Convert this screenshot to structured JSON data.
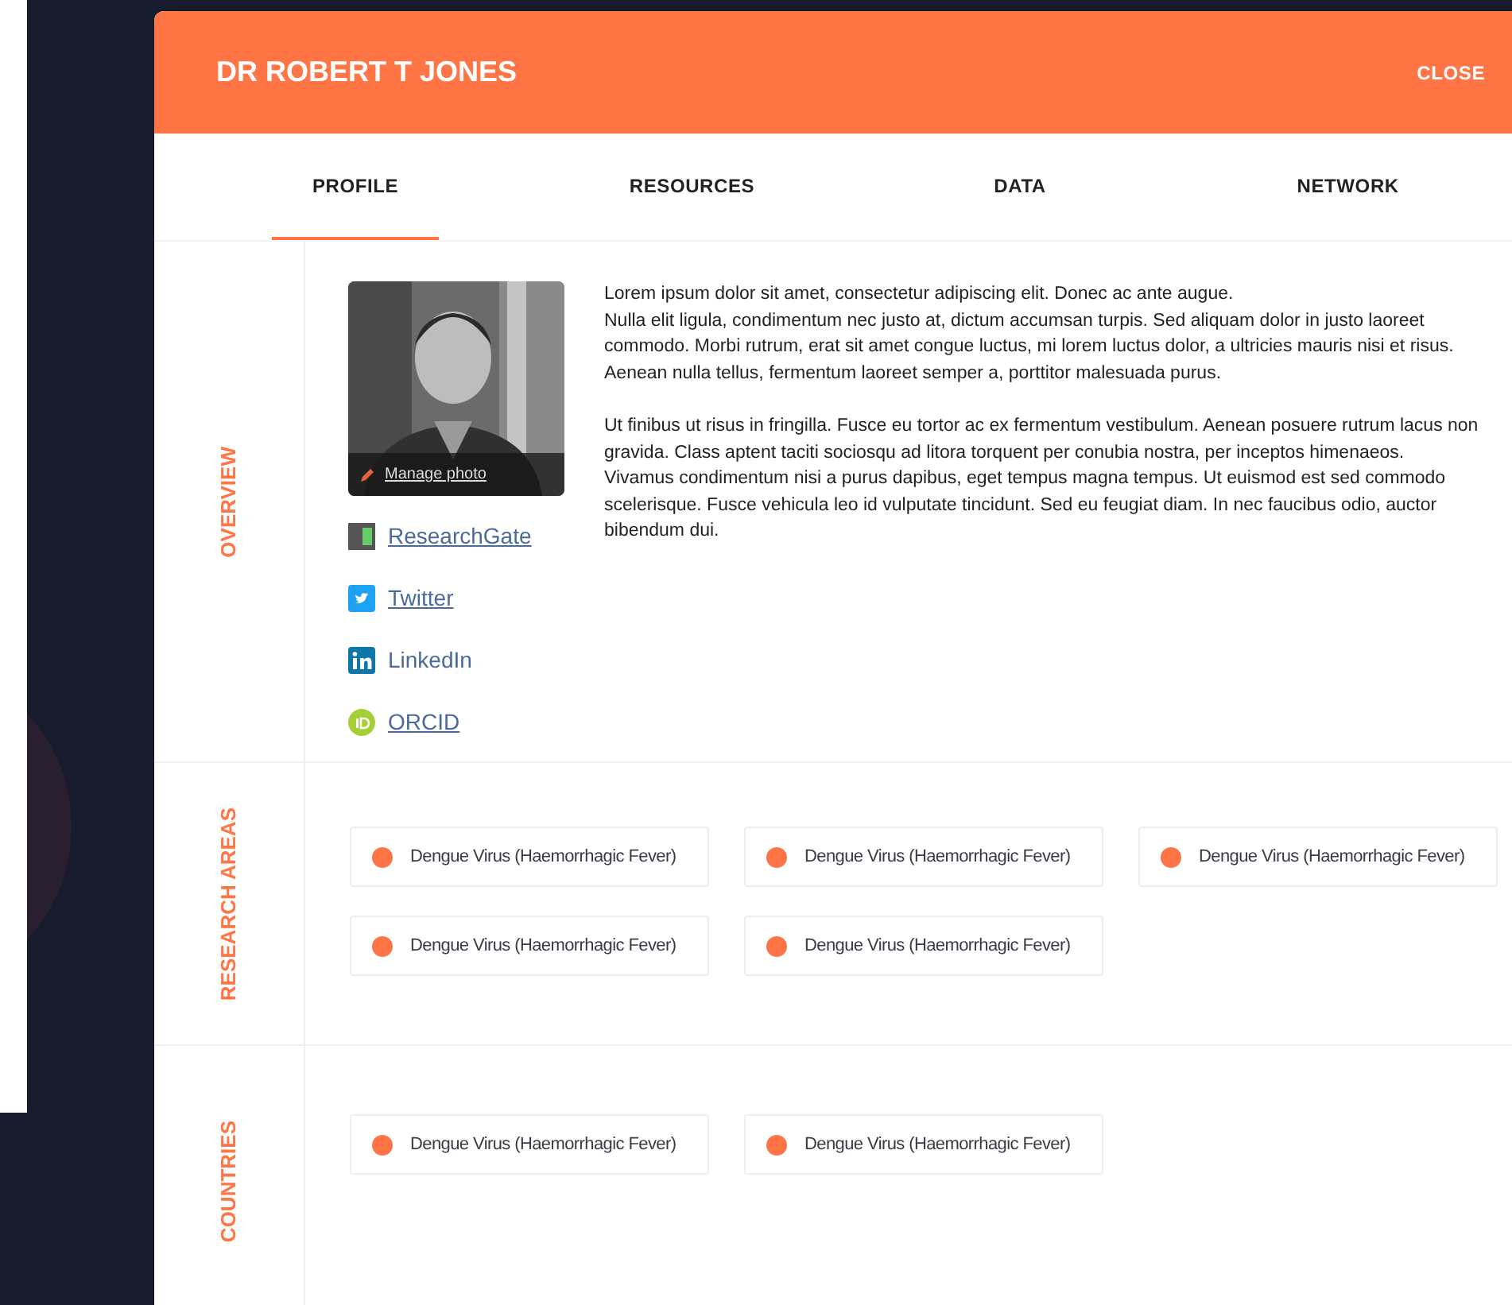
{
  "modal": {
    "title": "DR ROBERT T JONES",
    "close": "CLOSE"
  },
  "tabs": [
    {
      "label": "PROFILE",
      "selected": true
    },
    {
      "label": "RESOURCES",
      "selected": false
    },
    {
      "label": "DATA",
      "selected": false
    },
    {
      "label": "NETWORK",
      "selected": false
    }
  ],
  "overview": {
    "label": "OVERVIEW",
    "photo": {
      "kind": "picture",
      "action": "Manage photo"
    },
    "links": [
      {
        "kind": "researchgate",
        "label": "ResearchGate"
      },
      {
        "kind": "twitter",
        "label": "Twitter"
      },
      {
        "kind": "linkedin",
        "label": "LinkedIn"
      },
      {
        "kind": "orcid",
        "label": "ORCID"
      }
    ],
    "paragraphs": [
      "Lorem ipsum dolor sit amet, consectetur adipiscing elit. Donec ac ante augue.\nNulla elit ligula, condimentum nec justo at, dictum accumsan turpis. Sed aliquam dolor in justo laoreet commodo. Morbi rutrum, erat sit amet congue luctus, mi lorem luctus dolor, a ultricies mauris nisi et risus. Aenean nulla tellus, fermentum laoreet semper a, porttitor malesuada purus.",
      "Ut finibus ut risus in fringilla. Fusce eu tortor ac ex fermentum vestibulum. Aenean posuere rutrum lacus non gravida. Class aptent taciti sociosqu ad litora torquent per conubia nostra, per inceptos himenaeos. Vivamus condimentum nisi a purus dapibus, eget tempus magna tempus. Ut euismod est sed commodo scelerisque. Fusce vehicula leo id vulputate tincidunt. Sed eu feugiat diam. In nec faucibus odio, auctor bibendum dui."
    ]
  },
  "research_areas": {
    "label": "RESEARCH AREAS",
    "tags": [
      "Dengue Virus (Haemorrhagic Fever)",
      "Dengue Virus (Haemorrhagic Fever)",
      "Dengue Virus (Haemorrhagic Fever)",
      "Dengue Virus (Haemorrhagic Fever)",
      "Dengue Virus (Haemorrhagic Fever)"
    ]
  },
  "countries": {
    "label": "COUNTRIES",
    "tags": [
      "Dengue Virus (Haemorrhagic Fever)",
      "Dengue Virus (Haemorrhagic Fever)"
    ]
  }
}
